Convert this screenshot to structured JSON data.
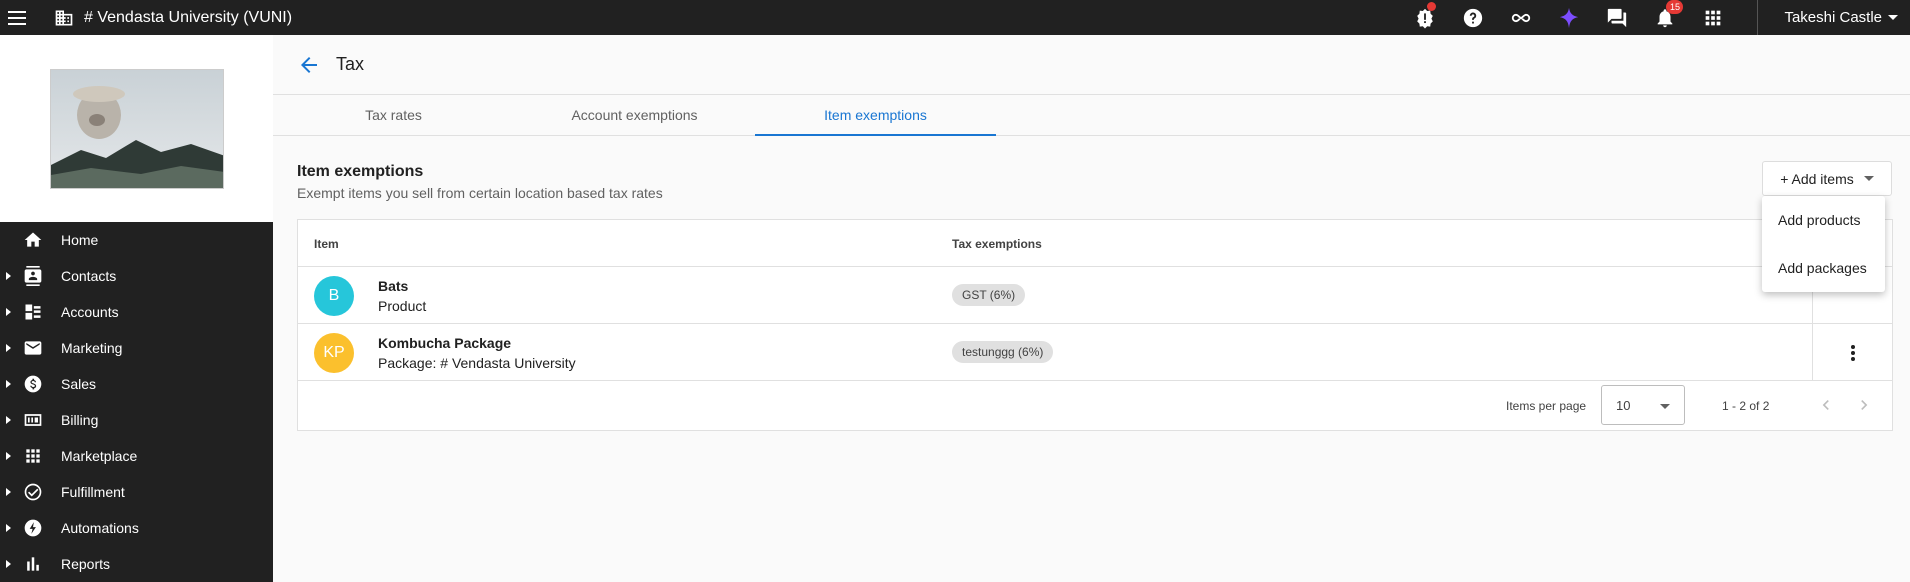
{
  "topbar": {
    "title": "# Vendasta University (VUNI)",
    "notification_count": "15",
    "user_name": "Takeshi Castle",
    "icons": [
      "menu-icon",
      "building-icon",
      "alert-icon",
      "help-icon",
      "infinity-icon",
      "sparkle-icon",
      "chat-icon",
      "bell-icon",
      "apps-icon"
    ],
    "colors": {
      "bar": "#212121",
      "badge": "#e53935",
      "sparkle": "#7c4dff"
    }
  },
  "sidebar": {
    "items": [
      {
        "label": "Home",
        "icon": "home-icon",
        "expandable": false
      },
      {
        "label": "Contacts",
        "icon": "contacts-icon",
        "expandable": true
      },
      {
        "label": "Accounts",
        "icon": "accounts-icon",
        "expandable": true
      },
      {
        "label": "Marketing",
        "icon": "mail-icon",
        "expandable": true
      },
      {
        "label": "Sales",
        "icon": "dollar-icon",
        "expandable": true
      },
      {
        "label": "Billing",
        "icon": "billing-icon",
        "expandable": true
      },
      {
        "label": "Marketplace",
        "icon": "grid-icon",
        "expandable": true
      },
      {
        "label": "Fulfillment",
        "icon": "check-circle-icon",
        "expandable": true
      },
      {
        "label": "Automations",
        "icon": "bolt-icon",
        "expandable": true
      },
      {
        "label": "Reports",
        "icon": "bar-chart-icon",
        "expandable": true
      }
    ]
  },
  "page": {
    "title": "Tax",
    "tabs": [
      {
        "label": "Tax rates",
        "active": false
      },
      {
        "label": "Account exemptions",
        "active": false
      },
      {
        "label": "Item exemptions",
        "active": true
      }
    ],
    "section_title": "Item exemptions",
    "section_subtitle": "Exempt items you sell from certain location based tax rates",
    "add_button": "+ Add items",
    "add_menu": [
      "Add products",
      "Add packages"
    ],
    "accent": "#1976d2"
  },
  "table": {
    "columns": [
      "Item",
      "Tax exemptions"
    ],
    "rows": [
      {
        "initials": "B",
        "name": "Bats",
        "type": "Product",
        "exemption": "GST (6%)",
        "avatar_color": "#26c6da"
      },
      {
        "initials": "KP",
        "name": "Kombucha Package",
        "type": "Package: # Vendasta University",
        "exemption": "testunggg (6%)",
        "avatar_color": "#fbc02d"
      }
    ],
    "items_per_page_label": "Items per page",
    "items_per_page": "10",
    "range": "1 - 2 of 2"
  }
}
